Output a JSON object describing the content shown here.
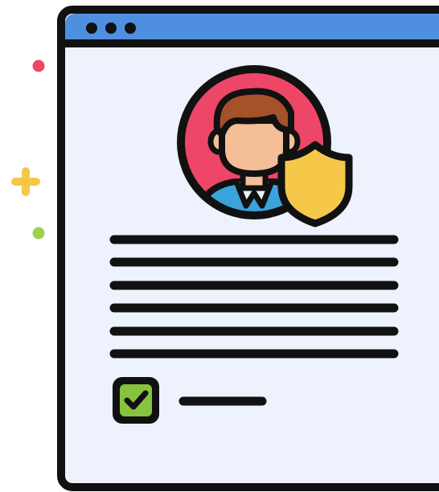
{
  "illustration": {
    "kind": "secure-user-profile-document",
    "icons": {
      "window_controls": [
        "dot-icon",
        "dot-icon",
        "dot-icon"
      ],
      "avatar": "user-avatar-icon",
      "shield": "shield-icon",
      "checkbox": "checkmark-icon",
      "decorations": [
        "dot-sparkle-icon",
        "plus-sparkle-icon",
        "dot-sparkle-icon"
      ]
    },
    "checkbox_checked": true,
    "text_line_count": 6,
    "colors": {
      "outline": "#111111",
      "titlebar": "#4f8fe0",
      "page": "#edf2fc",
      "avatar_bg": "#ee4667",
      "skin": "#f4be97",
      "hair": "#a5512a",
      "shirt": "#3aa3dc",
      "shield": "#f6c84a",
      "checkbox": "#86c440",
      "sparkle_red": "#ee4667",
      "sparkle_yellow": "#f6c84a",
      "sparkle_green": "#9bd151"
    }
  }
}
